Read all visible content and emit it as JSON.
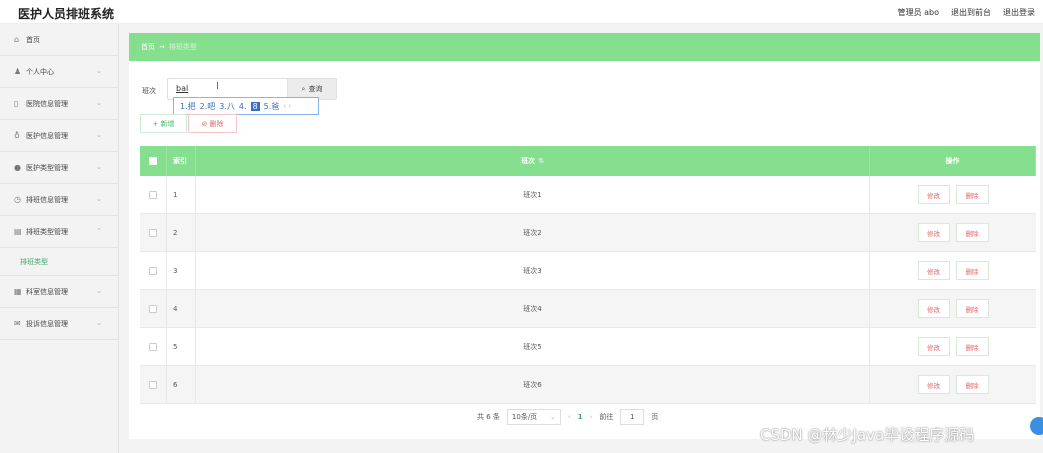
{
  "header": {
    "app_title": "医护人员排班系统",
    "user_label": "管理员 abo",
    "back_to_front": "退出到前台",
    "logout": "退出登录"
  },
  "sidebar": {
    "items": [
      {
        "label": "首页",
        "icon": "home-icon",
        "expanded": false
      },
      {
        "label": "个人中心",
        "icon": "user-icon",
        "expanded": false
      },
      {
        "label": "医院信息管理",
        "icon": "hospital-icon",
        "expanded": false
      },
      {
        "label": "医护信息管理",
        "icon": "stethoscope-icon",
        "expanded": false
      },
      {
        "label": "医护类型管理",
        "icon": "tag-icon",
        "expanded": false
      },
      {
        "label": "排班信息管理",
        "icon": "clock-icon",
        "expanded": false
      },
      {
        "label": "排班类型管理",
        "icon": "calendar-icon",
        "expanded": true
      },
      {
        "label": "科室信息管理",
        "icon": "department-icon",
        "expanded": false
      },
      {
        "label": "投诉信息管理",
        "icon": "mail-icon",
        "expanded": false
      }
    ],
    "sub_active": "排班类型"
  },
  "breadcrumb": {
    "home": "首页",
    "arrow": "→",
    "current": "排班类型"
  },
  "search": {
    "label": "班次",
    "value": "bal",
    "query_label": "查询"
  },
  "ime": {
    "candidates": [
      "1.把",
      "2.吧",
      "3.八",
      "4."
    ],
    "selected": "8",
    "next": "5.爸"
  },
  "actions": {
    "add_label": "+ 新增",
    "delete_label": "删除"
  },
  "table": {
    "headers": {
      "index": "索引",
      "name": "班次",
      "ops": "操作"
    },
    "rows": [
      {
        "index": "1",
        "name": "班次1"
      },
      {
        "index": "2",
        "name": "班次2"
      },
      {
        "index": "3",
        "name": "班次3"
      },
      {
        "index": "4",
        "name": "班次4"
      },
      {
        "index": "5",
        "name": "班次5"
      },
      {
        "index": "6",
        "name": "班次6"
      }
    ],
    "edit_label": "修改",
    "delete_label": "删除"
  },
  "pagination": {
    "total": "共 6 条",
    "page_size": "10条/页",
    "current_page": "1",
    "goto_label": "前往",
    "goto_value": "1",
    "page_suffix": "页"
  },
  "watermark": "CSDN @林少Java毕设程序源码",
  "colors": {
    "accent_green": "#86df8e",
    "danger_red": "#e06666",
    "active_text": "#3aa86b"
  }
}
